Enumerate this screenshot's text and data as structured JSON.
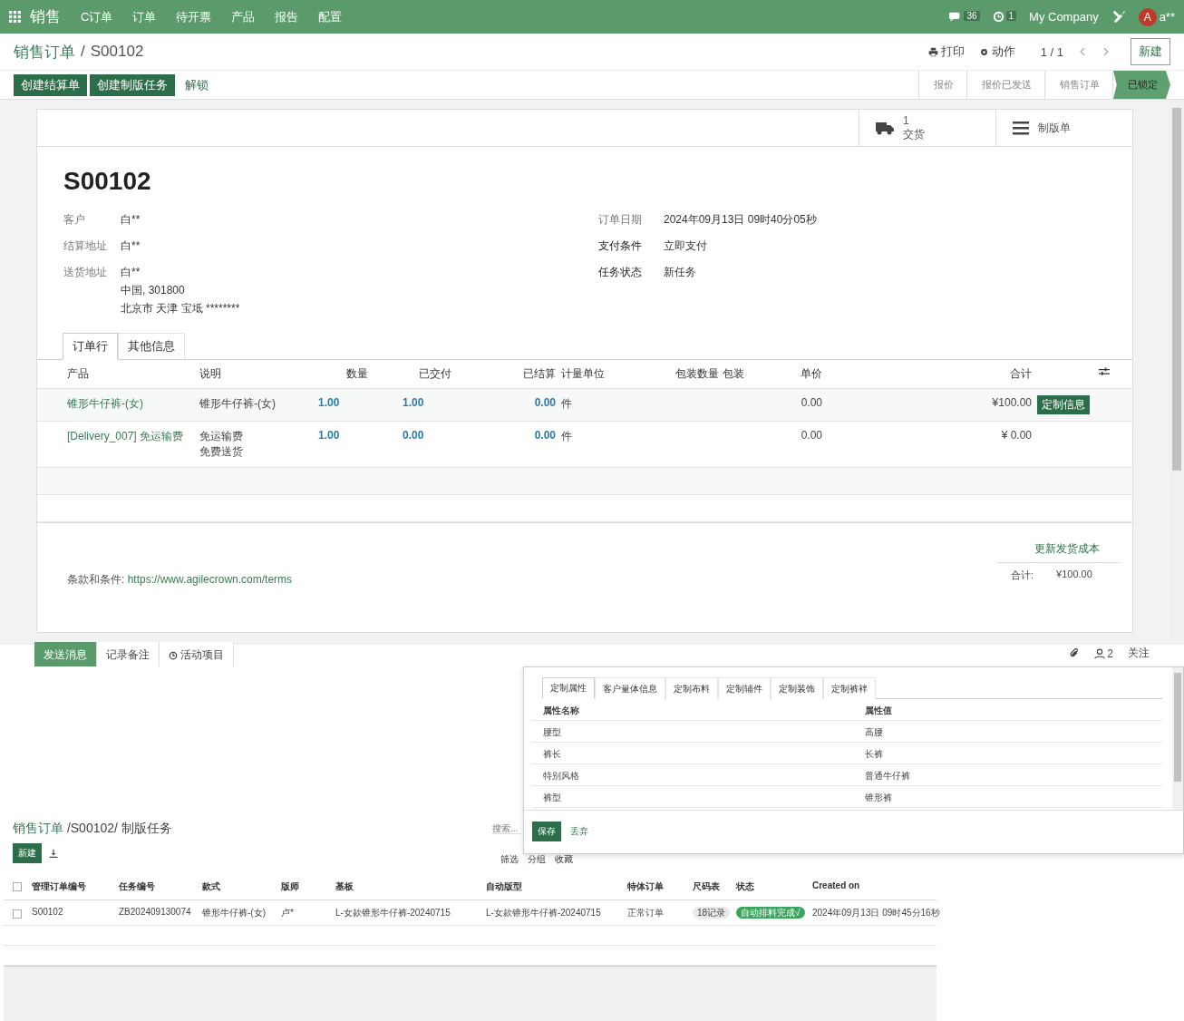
{
  "navbar": {
    "app": "销售",
    "menu": [
      "C订单",
      "订单",
      "待开票",
      "产品",
      "报告",
      "配置"
    ],
    "messages_count": "36",
    "activity_count": "1",
    "company": "My Company",
    "user_initial": "A",
    "user_name": "a**"
  },
  "control_panel": {
    "breadcrumb": "销售订单",
    "separator": "/",
    "record": "S00102",
    "print": "打印",
    "action": "动作",
    "pager": "1 / 1",
    "new": "新建"
  },
  "header_buttons": [
    {
      "label": "创建结算单",
      "kind": "primary"
    },
    {
      "label": "创建制版任务",
      "kind": "primary"
    },
    {
      "label": "解锁",
      "kind": "link"
    }
  ],
  "stages": [
    {
      "label": "报价",
      "selected": false
    },
    {
      "label": "报价已发送",
      "selected": false
    },
    {
      "label": "销售订单",
      "selected": false
    },
    {
      "label": "已锁定",
      "selected": true
    }
  ],
  "smart_buttons": [
    {
      "kind": "delivery",
      "count": "1",
      "label": "交货"
    },
    {
      "kind": "menu",
      "label": "制版单"
    }
  ],
  "form": {
    "name": "S00102",
    "left_fields": [
      {
        "label": "客户",
        "value": "白**"
      },
      {
        "label": "结算地址",
        "value": "白**"
      },
      {
        "label": "送货地址",
        "value": "白**",
        "lines": [
          "中国, 301800",
          "北京市 天津 宝坻 ********"
        ]
      }
    ],
    "right_fields": [
      {
        "label": "订单日期",
        "value": "2024年09月13日 09时40分05秒",
        "strong": false
      },
      {
        "label": "支付条件",
        "value": "立即支付",
        "strong": true
      },
      {
        "label": "任务状态",
        "value": "新任务",
        "strong": true
      }
    ]
  },
  "tabs": [
    {
      "label": "订单行",
      "selected": true
    },
    {
      "label": "其他信息",
      "selected": false
    }
  ],
  "order_lines": {
    "columns": [
      "产品",
      "说明",
      "数量",
      "已交付",
      "已结算",
      "计量单位",
      "包装数量",
      "包装",
      "单价",
      "合计"
    ],
    "rows": [
      {
        "product": "锥形牛仔裤-(女)",
        "description": [
          "锥形牛仔裤-(女)"
        ],
        "quantity": "1.00",
        "delivered": "1.00",
        "invoiced": "0.00",
        "uom": "件",
        "unit_price": "0.00",
        "subtotal": "¥100.00",
        "action": "定制信息"
      },
      {
        "product": "[Delivery_007] 免运输费",
        "description": [
          "免运输费",
          "免费送货"
        ],
        "quantity": "1.00",
        "delivered": "0.00",
        "invoiced": "0.00",
        "uom": "件",
        "unit_price": "0.00",
        "subtotal": "¥ 0.00"
      }
    ]
  },
  "terms": {
    "label": "条款和条件:",
    "link": "https://www.agilecrown.com/terms"
  },
  "update_shipping": "更新发货成本",
  "total": {
    "label": "合计:",
    "value": "¥100.00"
  },
  "chatter": {
    "tabs": [
      {
        "label": "发送消息",
        "kind": "primary"
      },
      {
        "label": "记录备注",
        "kind": "plain"
      },
      {
        "label": "活动项目",
        "kind": "activity"
      }
    ],
    "followers": "2",
    "follow": "关注"
  },
  "dialog": {
    "tabs": [
      {
        "label": "定制属性",
        "selected": true
      },
      {
        "label": "客户量体信息",
        "selected": false
      },
      {
        "label": "定制布料",
        "selected": false
      },
      {
        "label": "定制辅件",
        "selected": false
      },
      {
        "label": "定制装饰",
        "selected": false
      },
      {
        "label": "定制裤袢",
        "selected": false
      }
    ],
    "columns": [
      "属性名称",
      "属性值"
    ],
    "rows": [
      [
        "腰型",
        "高腰"
      ],
      [
        "裤长",
        "长裤"
      ],
      [
        "特别风格",
        "普通牛仔裤"
      ],
      [
        "裤型",
        "锥形裤"
      ]
    ],
    "save": "保存",
    "discard": "丢弃"
  },
  "task_list": {
    "select_all_checked": false,
    "breadcrumb": "销售订单",
    "path": "/S00102/ 制版任务",
    "new": "新建",
    "search_placeholder": "搜索...",
    "filters": [
      "筛选",
      "分组",
      "收藏"
    ],
    "columns": [
      "管理订单编号",
      "任务编号",
      "款式",
      "版师",
      "基板",
      "自动版型",
      "特体订单",
      "尺码表",
      "状态",
      "Created on"
    ],
    "rows": [
      {
        "checked": false,
        "cells": [
          "S00102",
          "ZB202409130074",
          "锥形牛仔裤-(女)",
          "卢*",
          "L-女款锥形牛仔裤-20240715",
          "L-女款锥形牛仔裤-20240715",
          "正常订单"
        ],
        "size_table": "18记录",
        "status": "自动排料完成√",
        "created": "2024年09月13日 09时45分16秒"
      }
    ]
  }
}
